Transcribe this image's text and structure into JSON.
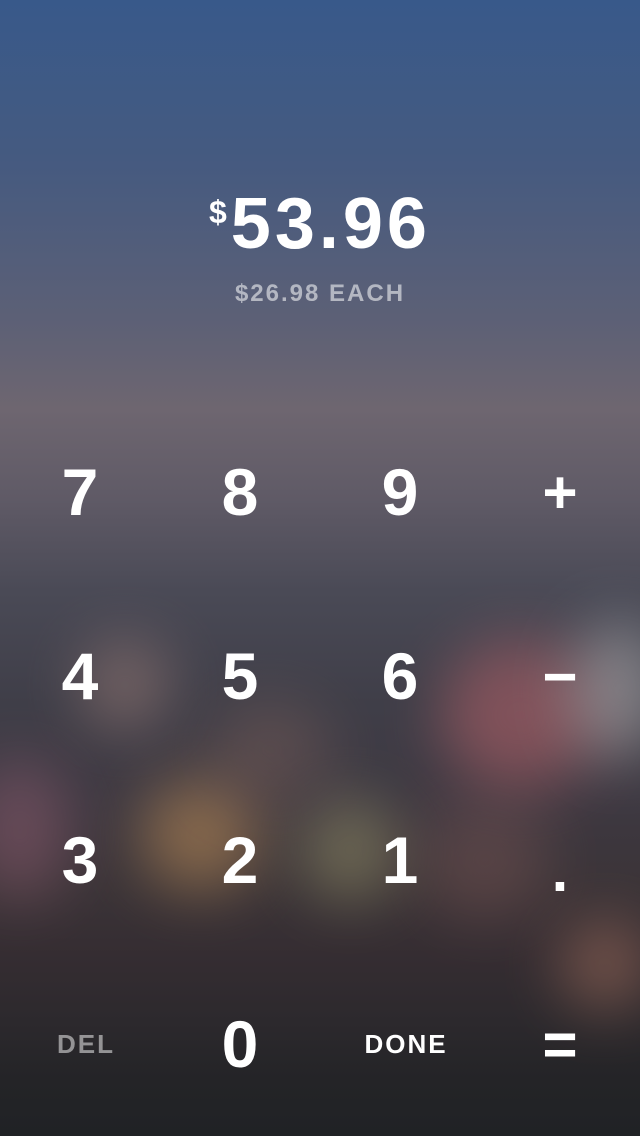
{
  "display": {
    "currency_symbol": "$",
    "total": "53.96",
    "per_person": "$26.98 EACH"
  },
  "keypad": {
    "row1": [
      "7",
      "8",
      "9",
      "+"
    ],
    "row2": [
      "4",
      "5",
      "6",
      "−"
    ],
    "row3": [
      "3",
      "2",
      "1",
      "."
    ],
    "row4": [
      "DEL",
      "0",
      "DONE",
      "="
    ]
  },
  "colors": {
    "text": "#ffffff",
    "muted_text": "rgba(255,255,255,0.55)",
    "background_top": "#38598a",
    "background_bottom": "#202225"
  }
}
